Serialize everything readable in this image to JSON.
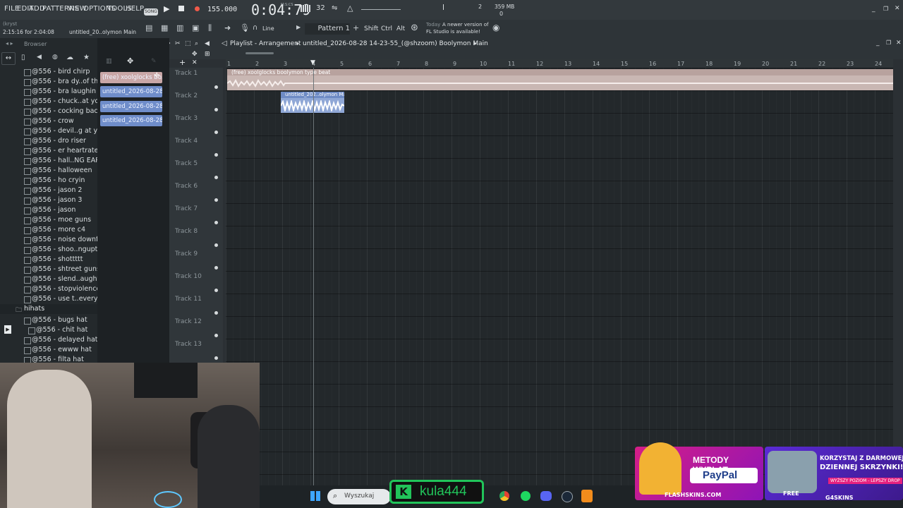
{
  "menu": [
    "FILE",
    "EDIT",
    "ADD",
    "PATTERNS",
    "VIEW",
    "OPTIONS",
    "TOOLS",
    "HELP"
  ],
  "transport": {
    "mode_label": "SONG",
    "tempo": "155.000",
    "time": "0:04:79",
    "time_units": "M:S:CS",
    "pattern_label": "Pattern 1",
    "snap_label": "Line",
    "cpu_mem": "359 MB",
    "voices": "0",
    "meter_top": "2"
  },
  "hints": {
    "user": "(kryst",
    "time_info": "2:15:16 for 2:04:08",
    "project": "untitled_20..olymon Main",
    "news_date": "Today",
    "news_text_1": "A newer version of",
    "news_text_2": "FL Studio is available!",
    "keys": [
      "Shift",
      "Ctrl",
      "Alt"
    ]
  },
  "browser": {
    "title": "Browser",
    "items": [
      "@556 - bird chirp",
      "@556 - bra dy..of the beat",
      "@556 - bra laughin at u",
      "@556 - chuck..at your cut",
      "@556 - cocking back gun",
      "@556 - crow",
      "@556 - devil..g at your cut",
      "@556 - dro riser",
      "@556 - er heartrate",
      "@556 - hall..NG EARRAPE)",
      "@556 - halloween",
      "@556 - ho cryin",
      "@556 - jason 2",
      "@556 - jason 3",
      "@556 - jason",
      "@556 - moe guns",
      "@556 - more c4",
      "@556 - noise downfall",
      "@556 - shoo..nguptheclub",
      "@556 - shottttt",
      "@556 - shtreet gunshot",
      "@556 - slend..aught u bro",
      "@556 - stopviolence",
      "@556 - use t..every 8 bars"
    ],
    "folder": "hihats",
    "sub_items": [
      "@556 - bugs hat",
      "@556 - chit hat",
      "@556 - delayed hat",
      "@556 - ewww hat",
      "@556 - filta hat"
    ]
  },
  "picker": {
    "clips": [
      {
        "label": "(free) xoolglocks bo...",
        "color": "#c9a7a7"
      },
      {
        "label": "untitled_2026-08-28 14-...",
        "color": "#6f8dca"
      },
      {
        "label": "untitled_2026-08-28 14-...",
        "color": "#6f8dca"
      },
      {
        "label": "untitled_2026-08-28 14-...",
        "color": "#6f8dca"
      }
    ]
  },
  "playlist": {
    "title": "Playlist - Arrangement",
    "breadcrumb": "untitled_2026-08-28 14-23-55_(@shzoom) Boolymon Main",
    "tracks": [
      "Track 1",
      "Track 2",
      "Track 3",
      "Track 4",
      "Track 5",
      "Track 6",
      "Track 7",
      "Track 8",
      "Track 9",
      "Track 10",
      "Track 11",
      "Track 12",
      "Track 13"
    ],
    "ruler": [
      "1",
      "2",
      "3",
      "4",
      "5",
      "6",
      "7",
      "8",
      "9",
      "10",
      "11",
      "12",
      "13",
      "14",
      "15",
      "16",
      "17",
      "18",
      "19",
      "20",
      "21",
      "22",
      "23",
      "24"
    ],
    "clip1_label": "(free) xoolglocks boolymon type beat",
    "clip2_label": "untitled_202..olymon Main"
  },
  "overlay": {
    "twitch_name": "kula444",
    "search_placeholder": "Wyszukaj",
    "promo1_title": "METODY WYPŁAT:",
    "promo1_brand": "PayPal",
    "promo1_site": "FLASHSKINS.COM",
    "promo2_line1": "KORZYSTAJ Z DARMOWEJ",
    "promo2_line2": "DZIENNEJ SKRZYNKI!",
    "promo2_line3": "WYŻSZY POZIOM - LEPSZY DROP",
    "promo2_free": "FREE",
    "promo2_site": "G4SKINS"
  },
  "colors": {
    "accent_clip": "#8fa7d6",
    "audio_clip": "#c9b7b3",
    "green": "#21c45a"
  }
}
